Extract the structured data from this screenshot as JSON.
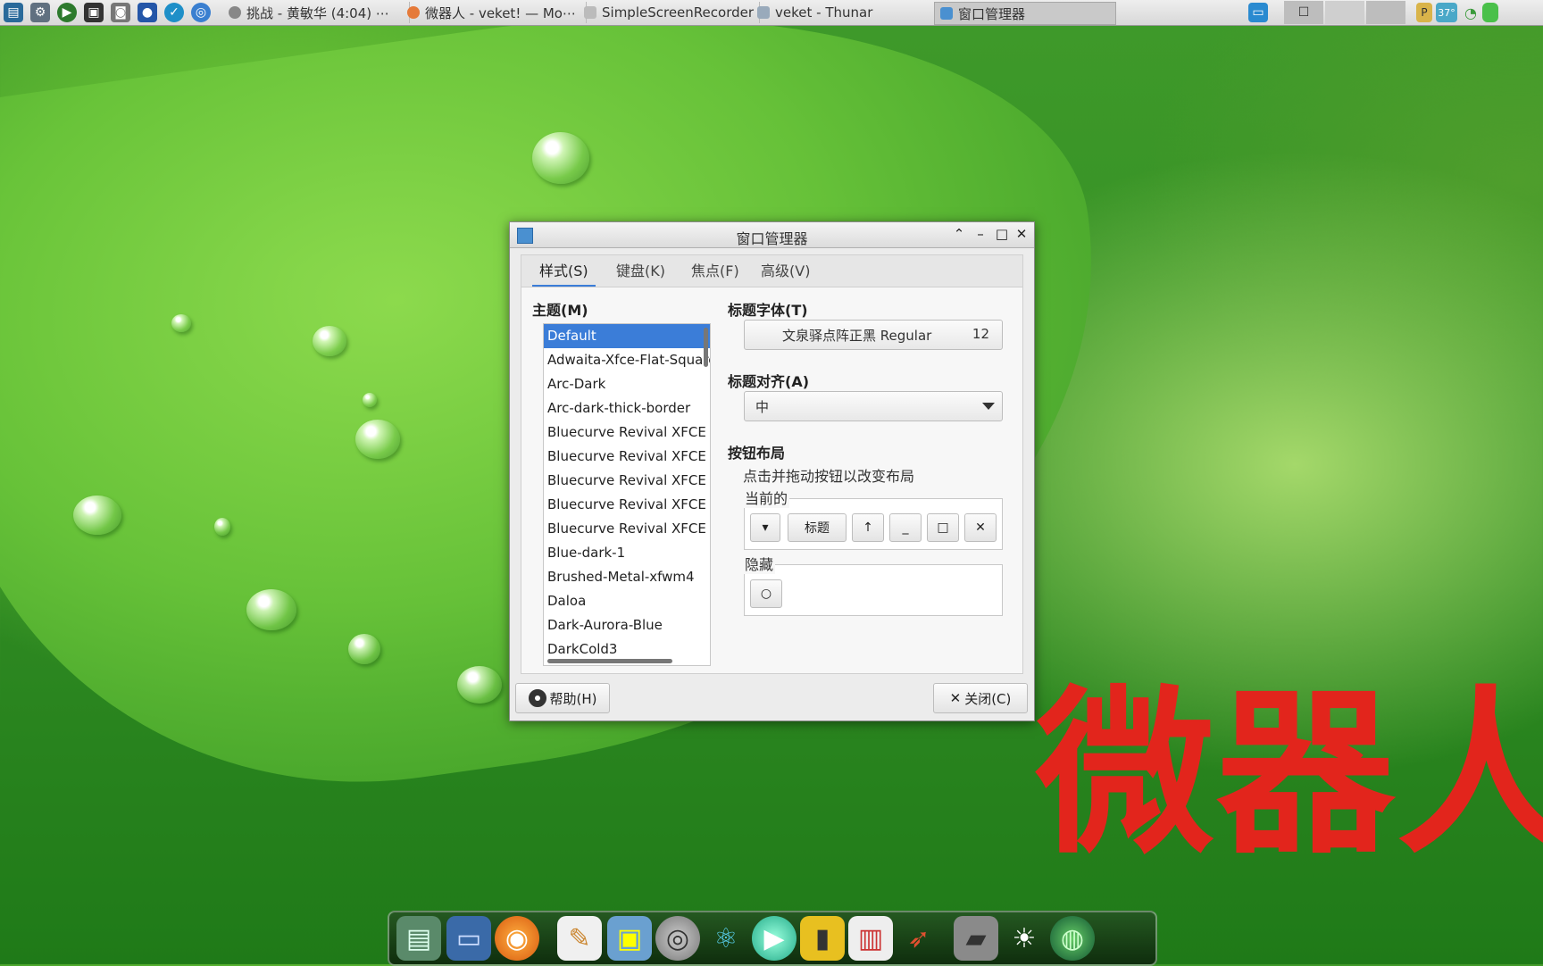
{
  "taskbar": {
    "tasks": [
      {
        "label": "挑战 - 黄敏华 (4:04) ⋯",
        "icon": "music-player-icon"
      },
      {
        "label": "微器人 - veket! — Mo⋯",
        "icon": "firefox-icon"
      },
      {
        "label": "SimpleScreenRecorder",
        "icon": "window-icon"
      },
      {
        "label": "veket - Thunar",
        "icon": "folder-icon"
      },
      {
        "label": "窗口管理器",
        "icon": "window-manager-icon"
      }
    ],
    "tray": {
      "temperature": "37°"
    }
  },
  "dialog": {
    "title": "窗口管理器",
    "tabs": [
      "样式(S)",
      "键盘(K)",
      "焦点(F)",
      "高级(V)"
    ],
    "theme_label": "主题(M)",
    "themes": [
      "Default",
      "Adwaita-Xfce-Flat-Squared",
      "Arc-Dark",
      "Arc-dark-thick-border",
      "Bluecurve Revival XFCE b",
      "Bluecurve Revival XFCE gr",
      "Bluecurve Revival XFCE or",
      "Bluecurve Revival XFCE re",
      "Bluecurve Revival XFCE vi",
      "Blue-dark-1",
      "Brushed-Metal-xfwm4",
      "Daloa",
      "Dark-Aurora-Blue",
      "DarkCold3"
    ],
    "selected_theme": "Default",
    "title_font_label": "标题字体(T)",
    "title_font_name": "文泉驿点阵正黑 Regular",
    "title_font_size": "12",
    "title_align_label": "标题对齐(A)",
    "title_align_value": "中",
    "button_layout_label": "按钮布局",
    "button_layout_hint": "点击并拖动按钮以改变布局",
    "current_label": "当前的",
    "current_buttons": [
      "▾",
      "标题",
      "↑",
      "_",
      "□",
      "✕"
    ],
    "hidden_label": "隐藏",
    "hidden_buttons": [
      "○"
    ],
    "help_button": "帮助(H)",
    "close_button": "关闭(C)"
  },
  "watermark": "微器人",
  "dock": {
    "items": [
      "desktop-icon",
      "monitor-icon",
      "firefox-icon",
      "text-editor-icon",
      "image-viewer-icon",
      "disk-icon",
      "atom-icon",
      "media-player-icon",
      "notebook-icon",
      "chart-icon",
      "rocket-icon",
      "drive-icon",
      "brightness-icon",
      "globe-icon"
    ]
  },
  "colors": {
    "accent": "#3b7dd8",
    "watermark": "#e2251c"
  }
}
